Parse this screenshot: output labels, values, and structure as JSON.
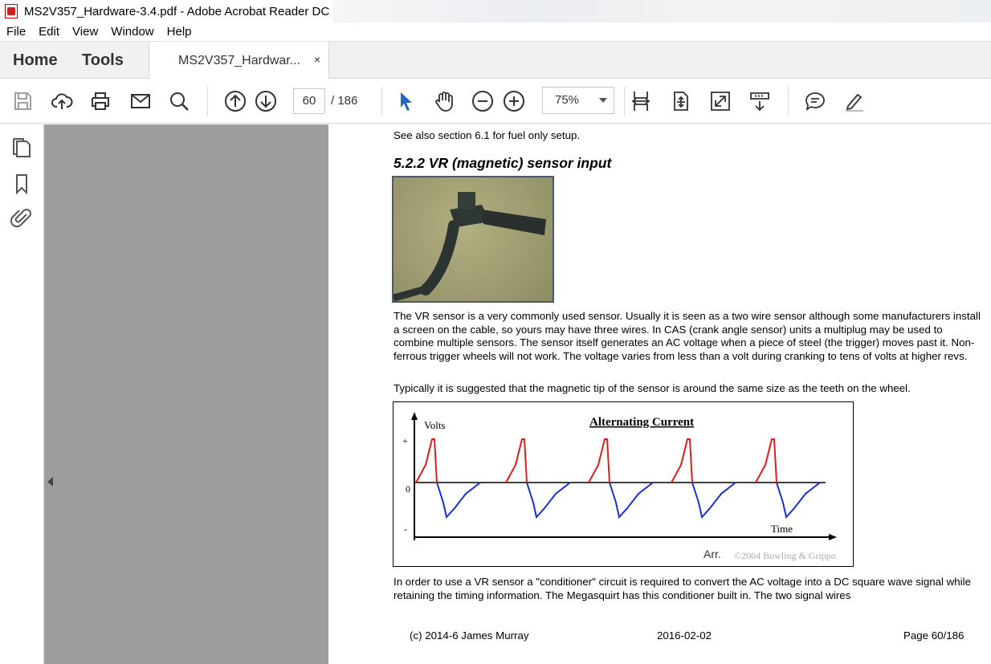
{
  "window": {
    "title": "MS2V357_Hardware-3.4.pdf - Adobe Acrobat Reader DC"
  },
  "menu": [
    "File",
    "Edit",
    "View",
    "Window",
    "Help"
  ],
  "tabs": {
    "home": "Home",
    "tools": "Tools",
    "document": "MS2V357_Hardwar...",
    "close": "×"
  },
  "toolbar": {
    "icons": [
      "save-icon",
      "cloud-upload-icon",
      "print-icon",
      "email-icon",
      "search-icon",
      "arrow-up-icon",
      "arrow-down-icon",
      "select-cursor-icon",
      "hand-icon",
      "zoom-out-icon",
      "zoom-in-icon",
      "fit-width-icon",
      "rotate-icon",
      "fullscreen-icon",
      "scroll-mode-icon",
      "comment-icon",
      "highlight-icon"
    ],
    "page_current": "60",
    "page_total": "/  186",
    "zoom": "75%"
  },
  "left_rail": {
    "icons": [
      "pages-icon",
      "bookmark-icon",
      "attachment-icon"
    ]
  },
  "document": {
    "line_top": "See also section 6.1 for fuel only setup.",
    "heading": "5.2.2 VR (magnetic) sensor input",
    "para1": "The VR sensor is a very commonly used sensor. Usually it is seen as a two wire sensor although some manufacturers install a screen on the cable, so yours may have three wires. In CAS (crank angle sensor) units a multiplug may be used to combine multiple sensors. The sensor itself generates an AC voltage when a piece of steel (the trigger) moves past it. Non-ferrous trigger wheels will not work. The voltage varies from less than a volt during cranking to tens of volts at higher revs.",
    "para2": "Typically it is suggested that the magnetic tip of the sensor is around the same size as the teeth on the wheel.",
    "para3": "In order to use a VR sensor a \"conditioner\" circuit is required to convert the AC voltage into a DC square wave signal while retaining the timing information. The Megasquirt has this conditioner built in. The two signal wires",
    "footer_left": "(c) 2014-6 James Murray",
    "footer_mid": "2016-02-02",
    "footer_right": "Page 60/186"
  },
  "figure": {
    "title": "Alternating Current",
    "y_label": "Volts",
    "x_label": "Time",
    "tick_plus": "+",
    "tick_zero": "0",
    "tick_minus": "-",
    "caption_arr": "Arr.",
    "copyright": "©2004 Bowling & Grippo",
    "pos_color": "#e31b1b",
    "neg_color": "#1a2fd6"
  }
}
